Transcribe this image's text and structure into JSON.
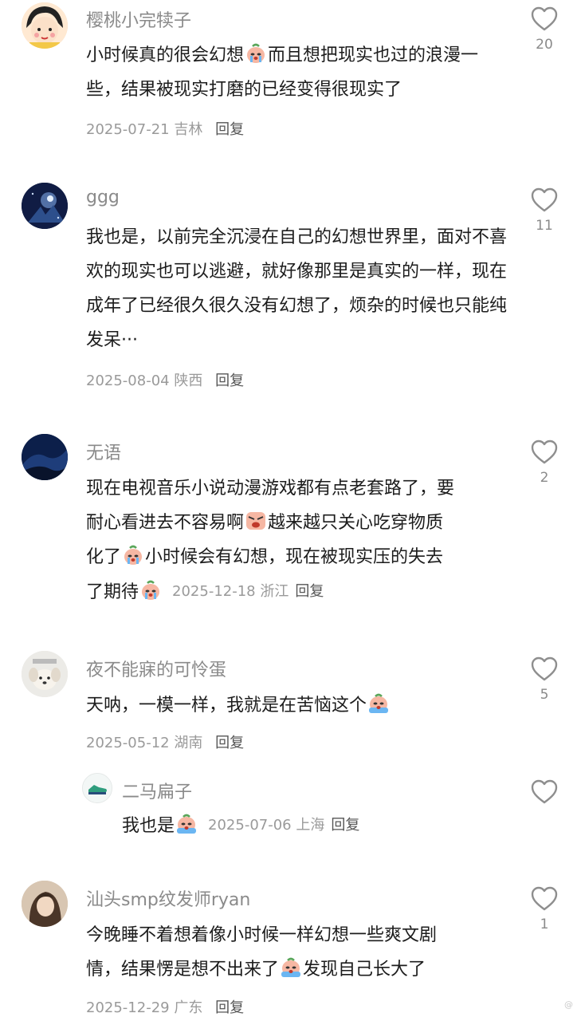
{
  "comments": [
    {
      "username": "樱桃小完犊子",
      "text_parts": [
        "小时候真的很会幻想",
        "而且想把现实也过的浪漫一些，结果被现实打磨的已经变得很现实了"
      ],
      "date": "2025-07-21",
      "location": "吉林",
      "reply": "回复",
      "likes": "20"
    },
    {
      "username": "ggg",
      "text": "我也是，以前完全沉浸在自己的幻想世界里，面对不喜欢的现实也可以逃避，就好像那里是真实的一样，现在成年了已经很久很久没有幻想了，烦杂的时候也只能纯发呆···",
      "date": "2025-08-04",
      "location": "陕西",
      "reply": "回复",
      "likes": "11"
    },
    {
      "username": "无语",
      "line1": "现在电视音乐小说动漫游戏都有点老套路了，要",
      "line2a": "耐心看进去不容易啊",
      "line2b": "越来越只关心吃穿物质",
      "line3a": "化了",
      "line3b": "小时候会有幻想，现在被现实压的失去",
      "line4": "了期待",
      "date": "2025-12-18",
      "location": "浙江",
      "reply": "回复",
      "likes": "2"
    },
    {
      "username": "夜不能寐的可怜蛋",
      "text": "天呐，一模一样，我就是在苦恼这个",
      "date": "2025-05-12",
      "location": "湖南",
      "reply": "回复",
      "likes": "5",
      "sub_reply": {
        "username": "二马扁子",
        "text": "我也是",
        "date": "2025-07-06",
        "location": "上海",
        "reply": "回复"
      }
    },
    {
      "username": "汕头smp纹发师ryan",
      "line1": "今晚睡不着想着像小时候一样幻想一些爽文剧",
      "line2a": "情，结果愣是想不出来了",
      "line2b": "发现自己长大了",
      "date": "2025-12-29",
      "location": "广东",
      "reply": "回复",
      "likes": "1"
    }
  ],
  "watermark": "@",
  "colors": {
    "username": "#8a8a8a",
    "meta": "#9a9a9a",
    "text": "#1c1c1c"
  },
  "icons": [
    "heart-outline-icon",
    "crying-emoji-icon",
    "sneaker-avatar-icon"
  ]
}
